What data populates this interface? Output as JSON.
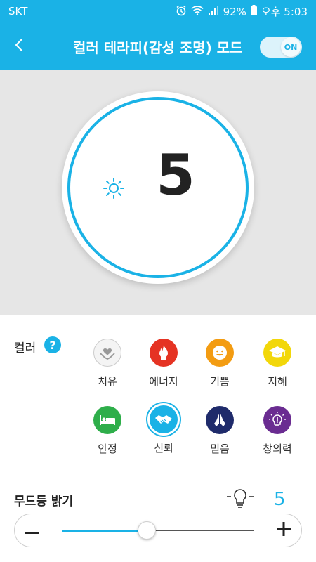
{
  "status_bar": {
    "carrier": "SKT",
    "battery": "92%",
    "time": "오후 5:03"
  },
  "header": {
    "title": "컬러 테라피(감성 조명) 모드",
    "toggle_label": "ON",
    "toggle_on": true
  },
  "dial": {
    "value": "5"
  },
  "colors": {
    "label": "컬러",
    "help": "?",
    "items": [
      {
        "label": "치유",
        "icon": "heart-hands-icon",
        "color": "#f2f2f2"
      },
      {
        "label": "에너지",
        "icon": "fire-icon",
        "color": "#e53323"
      },
      {
        "label": "기쁨",
        "icon": "smile-icon",
        "color": "#f39c12"
      },
      {
        "label": "지혜",
        "icon": "graduation-cap-icon",
        "color": "#f2d70a"
      },
      {
        "label": "안정",
        "icon": "bed-icon",
        "color": "#2eae4a"
      },
      {
        "label": "신뢰",
        "icon": "handshake-icon",
        "color": "#1ab2e6"
      },
      {
        "label": "믿음",
        "icon": "praying-hands-icon",
        "color": "#1f2b6b"
      },
      {
        "label": "창의력",
        "icon": "idea-bulb-icon",
        "color": "#6a2c91"
      }
    ],
    "selected": "신뢰"
  },
  "mood": {
    "label": "무드등 밝기",
    "value": "5",
    "level_fraction": 0.44,
    "minus": "−",
    "plus": "+"
  },
  "accent_color": "#1ab2e6"
}
